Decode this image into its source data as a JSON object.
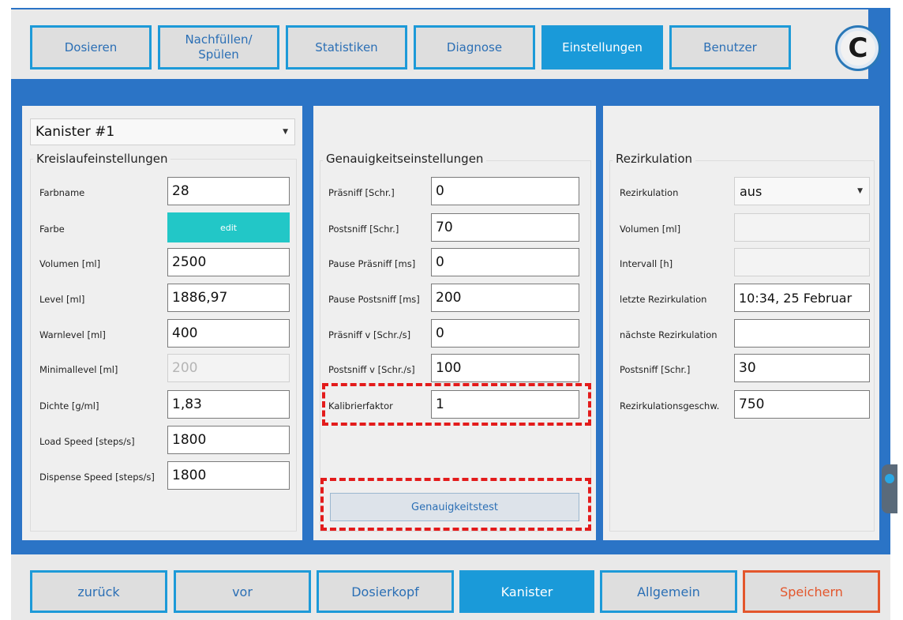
{
  "tabs": [
    {
      "label": "Dosieren",
      "active": false
    },
    {
      "label": "Nachfüllen/\nSpülen",
      "active": false
    },
    {
      "label": "Statistiken",
      "active": false
    },
    {
      "label": "Diagnose",
      "active": false
    },
    {
      "label": "Einstellungen",
      "active": true
    },
    {
      "label": "Benutzer",
      "active": false
    }
  ],
  "refresh_icon": "refresh-icon",
  "left": {
    "selector": "Kanister #1",
    "title": "Kreislaufeinstellungen",
    "rows": [
      {
        "label": "Farbname",
        "value": "28"
      },
      {
        "label": "Farbe",
        "value": "edit"
      },
      {
        "label": "Volumen [ml]",
        "value": "2500"
      },
      {
        "label": "Level [ml]",
        "value": "1886,97"
      },
      {
        "label": "Warnlevel [ml]",
        "value": "400"
      },
      {
        "label": "Minimallevel [ml]",
        "value": "200"
      },
      {
        "label": "Dichte [g/ml]",
        "value": "1,83"
      },
      {
        "label": "Load Speed [steps/s]",
        "value": "1800"
      },
      {
        "label": "Dispense Speed [steps/s]",
        "value": "1800"
      }
    ]
  },
  "middle": {
    "title": "Genauigkeitseinstellungen",
    "rows": [
      {
        "label": "Präsniff [Schr.]",
        "value": "0"
      },
      {
        "label": "Postsniff [Schr.]",
        "value": "70"
      },
      {
        "label": "Pause Präsniff [ms]",
        "value": "0"
      },
      {
        "label": "Pause Postsniff [ms]",
        "value": "200"
      },
      {
        "label": "Präsniff v [Schr./s]",
        "value": "0"
      },
      {
        "label": "Postsniff v [Schr./s]",
        "value": "100"
      },
      {
        "label": "Kalibrierfaktor",
        "value": "1"
      }
    ],
    "test_button": "Genauigkeitstest"
  },
  "right": {
    "title": "Rezirkulation",
    "rows": [
      {
        "label": "Rezirkulation",
        "value": "aus"
      },
      {
        "label": "Volumen [ml]",
        "value": ""
      },
      {
        "label": "Intervall [h]",
        "value": ""
      },
      {
        "label": "letzte Rezirkulation",
        "value": "10:34, 25 Februar"
      },
      {
        "label": "nächste Rezirkulation",
        "value": ""
      },
      {
        "label": "Postsniff [Schr.]",
        "value": "30"
      },
      {
        "label": "Rezirkulationsgeschw.",
        "value": "750"
      }
    ]
  },
  "bottom": [
    {
      "label": "zurück"
    },
    {
      "label": "vor"
    },
    {
      "label": "Dosierkopf"
    },
    {
      "label": "Kanister",
      "active": true
    },
    {
      "label": "Allgemein"
    },
    {
      "label": "Speichern",
      "accent": "#e3562c"
    }
  ],
  "colors": {
    "accent": "#1a9ad9",
    "frame": "#2b74c6",
    "farbe_swatch": "#22c7c7",
    "highlight": "#e31b1b"
  }
}
